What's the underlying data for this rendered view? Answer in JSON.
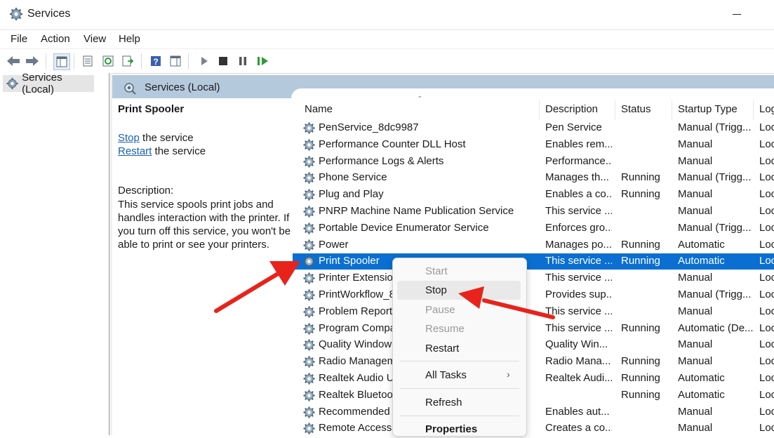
{
  "window": {
    "title": "Services",
    "icon": "gear-icon"
  },
  "menu": [
    "File",
    "Action",
    "View",
    "Help"
  ],
  "toolbar_icons": [
    "back-arrow-icon",
    "forward-arrow-icon",
    "console-tree-icon",
    "properties-icon",
    "refresh-icon",
    "export-list-icon",
    "help-icon",
    "show-hide-icon",
    "play-icon",
    "stop-square-icon",
    "pause-icon",
    "restart-icon"
  ],
  "tree": {
    "label": "Services (Local)"
  },
  "pane": {
    "title": "Services (Local)"
  },
  "details": {
    "service_name": "Print Spooler",
    "stop_link": "Stop",
    "stop_suffix": " the service",
    "restart_link": "Restart",
    "restart_suffix": " the service",
    "desc_label": "Description:",
    "desc_text": "This service spools print jobs and handles interaction with the printer. If you turn off this service, you won't be able to print or see your printers."
  },
  "columns": [
    "Name",
    "Description",
    "Status",
    "Startup Type",
    "Log"
  ],
  "rows": [
    {
      "name": "PenService_8dc9987",
      "desc": "Pen Service",
      "status": "",
      "startup": "Manual (Trigg...",
      "log": "Loc"
    },
    {
      "name": "Performance Counter DLL Host",
      "desc": "Enables rem...",
      "status": "",
      "startup": "Manual",
      "log": "Loc"
    },
    {
      "name": "Performance Logs & Alerts",
      "desc": "Performance...",
      "status": "",
      "startup": "Manual",
      "log": "Loc"
    },
    {
      "name": "Phone Service",
      "desc": "Manages th...",
      "status": "Running",
      "startup": "Manual (Trigg...",
      "log": "Loc"
    },
    {
      "name": "Plug and Play",
      "desc": "Enables a co...",
      "status": "Running",
      "startup": "Manual",
      "log": "Loc"
    },
    {
      "name": "PNRP Machine Name Publication Service",
      "desc": "This service ...",
      "status": "",
      "startup": "Manual",
      "log": "Loc"
    },
    {
      "name": "Portable Device Enumerator Service",
      "desc": "Enforces gro...",
      "status": "",
      "startup": "Manual (Trigg...",
      "log": "Loc"
    },
    {
      "name": "Power",
      "desc": "Manages po...",
      "status": "Running",
      "startup": "Automatic",
      "log": "Loc"
    },
    {
      "name": "Print Spooler",
      "desc": "This service ...",
      "status": "Running",
      "startup": "Automatic",
      "log": "Loc"
    },
    {
      "name": "Printer Extension",
      "desc": "This service ...",
      "status": "",
      "startup": "Manual",
      "log": "Loc"
    },
    {
      "name": "PrintWorkflow_8",
      "desc": "Provides sup...",
      "status": "",
      "startup": "Manual (Trigg...",
      "log": "Loc"
    },
    {
      "name": "Problem Reports",
      "desc": "This service ...",
      "status": "",
      "startup": "Manual",
      "log": "Loc"
    },
    {
      "name": "Program Compa",
      "desc": "This service ...",
      "status": "Running",
      "startup": "Automatic (De...",
      "log": "Loc"
    },
    {
      "name": "Quality Window",
      "desc": "Quality Win...",
      "status": "",
      "startup": "Manual",
      "log": "Loc"
    },
    {
      "name": "Radio Managem",
      "desc": "Radio Mana...",
      "status": "Running",
      "startup": "Manual",
      "log": "Loc"
    },
    {
      "name": "Realtek Audio U",
      "desc": "Realtek Audi...",
      "status": "Running",
      "startup": "Automatic",
      "log": "Loc"
    },
    {
      "name": "Realtek Bluetoo",
      "desc": "",
      "status": "Running",
      "startup": "Automatic",
      "log": "Loc"
    },
    {
      "name": "Recommended T",
      "desc": "Enables aut...",
      "status": "",
      "startup": "Manual",
      "log": "Loc"
    },
    {
      "name": "Remote Access A",
      "desc": "Creates a co...",
      "status": "",
      "startup": "Manual",
      "log": "Loc"
    }
  ],
  "selected_row": "Print Spooler",
  "context_menu": {
    "start": "Start",
    "stop": "Stop",
    "pause": "Pause",
    "resume": "Resume",
    "restart": "Restart",
    "all_tasks": "All Tasks",
    "refresh": "Refresh",
    "properties": "Properties"
  },
  "colors": {
    "selection": "#0a6fd1",
    "pane_header": "#b5c9dd",
    "annotation_arrow": "#e8231b",
    "link": "#1a5fb4"
  }
}
